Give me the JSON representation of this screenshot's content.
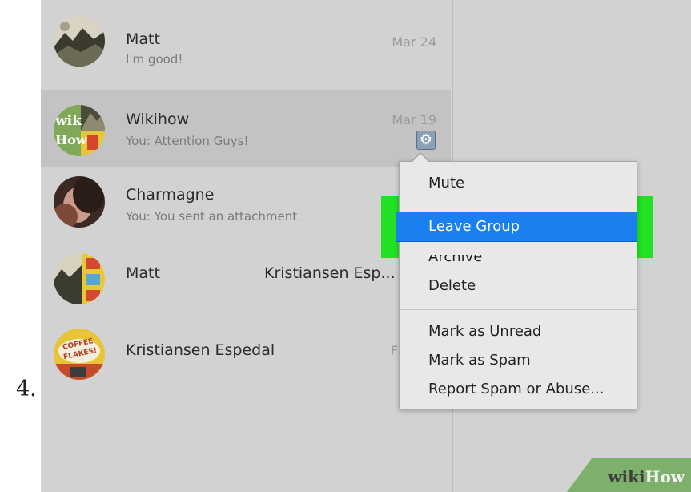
{
  "step_label": "4.",
  "conversations": [
    {
      "name": "Matt",
      "snippet": "I'm good!",
      "date": "Mar 24",
      "selected": false
    },
    {
      "name": "Wikihow",
      "snippet": "You: Attention Guys!",
      "date": "Mar 19",
      "selected": true
    },
    {
      "name": "Charmagne",
      "snippet": "You: You sent an attachment.",
      "date": "",
      "selected": false
    },
    {
      "name": "Matt",
      "name_part2": "Kristiansen Esp...",
      "snippet": "",
      "date": "",
      "selected": false
    },
    {
      "name": "Kristiansen Espedal",
      "snippet": "",
      "date": "F",
      "selected": false
    }
  ],
  "avatars": {
    "wikihow_text_line1": "wik",
    "wikihow_text_line2": "How",
    "coffee_text_line1": "COFFEE",
    "coffee_text_line2": "FLAKES!"
  },
  "context_menu": {
    "items": [
      {
        "label": "Mute"
      },
      {
        "label": "Leave Group"
      },
      {
        "label": "Archive"
      },
      {
        "label": "Delete"
      },
      {
        "label": "Mark as Unread"
      },
      {
        "label": "Mark as Spam"
      },
      {
        "label": "Report Spam or Abuse..."
      }
    ]
  },
  "watermark": {
    "wiki": "wiki",
    "how": "How"
  },
  "icons": {
    "settings": "gear-icon"
  },
  "colors": {
    "highlight": "#22e122",
    "selected_item": "#1a7fef",
    "panel": "#d2d2d2"
  }
}
